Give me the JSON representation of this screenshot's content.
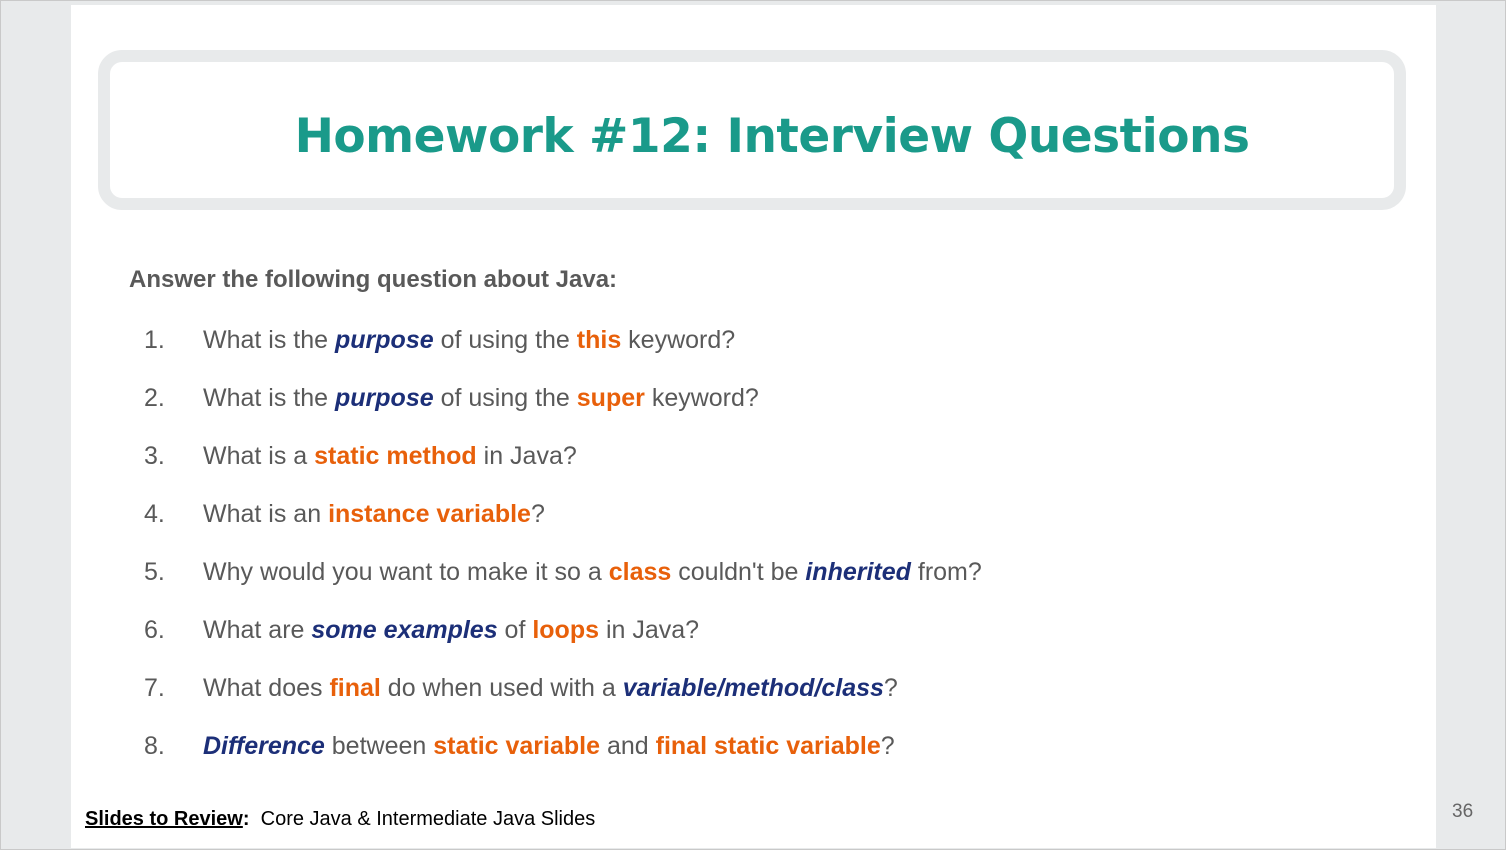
{
  "slide": {
    "title": "Homework #12: Interview Questions",
    "intro": "Answer the following question about Java:",
    "questions": [
      {
        "num": "1.",
        "parts": [
          {
            "t": "What is the ",
            "s": "n"
          },
          {
            "t": "purpose",
            "s": "b"
          },
          {
            "t": " of using the ",
            "s": "n"
          },
          {
            "t": "this",
            "s": "o"
          },
          {
            "t": " keyword?",
            "s": "n"
          }
        ]
      },
      {
        "num": "2.",
        "parts": [
          {
            "t": "What is the ",
            "s": "n"
          },
          {
            "t": "purpose",
            "s": "b"
          },
          {
            "t": " of using the ",
            "s": "n"
          },
          {
            "t": "super",
            "s": "o"
          },
          {
            "t": " keyword?",
            "s": "n"
          }
        ]
      },
      {
        "num": "3.",
        "parts": [
          {
            "t": "What is a ",
            "s": "n"
          },
          {
            "t": "static method",
            "s": "o"
          },
          {
            "t": " in Java?",
            "s": "n"
          }
        ]
      },
      {
        "num": "4.",
        "parts": [
          {
            "t": "What is an ",
            "s": "n"
          },
          {
            "t": "instance variable",
            "s": "o"
          },
          {
            "t": "?",
            "s": "n"
          }
        ]
      },
      {
        "num": "5.",
        "parts": [
          {
            "t": "Why would you want to make it so a ",
            "s": "n"
          },
          {
            "t": "class",
            "s": "o"
          },
          {
            "t": " couldn't be ",
            "s": "n"
          },
          {
            "t": "inherited",
            "s": "b"
          },
          {
            "t": " from?",
            "s": "n"
          }
        ]
      },
      {
        "num": "6.",
        "parts": [
          {
            "t": "What are ",
            "s": "n"
          },
          {
            "t": "some examples",
            "s": "b"
          },
          {
            "t": " of ",
            "s": "n"
          },
          {
            "t": "loops",
            "s": "o"
          },
          {
            "t": " in Java?",
            "s": "n"
          }
        ]
      },
      {
        "num": "7.",
        "parts": [
          {
            "t": "What does ",
            "s": "n"
          },
          {
            "t": "final",
            "s": "o"
          },
          {
            "t": " do when used with a ",
            "s": "n"
          },
          {
            "t": "variable/method/class",
            "s": "b"
          },
          {
            "t": "?",
            "s": "n"
          }
        ]
      },
      {
        "num": "8.",
        "parts": [
          {
            "t": "Difference",
            "s": "b"
          },
          {
            "t": " between ",
            "s": "n"
          },
          {
            "t": "static variable",
            "s": "o"
          },
          {
            "t": " and ",
            "s": "n"
          },
          {
            "t": "final static variable",
            "s": "o"
          },
          {
            "t": "?",
            "s": "n"
          }
        ]
      }
    ],
    "footer": {
      "label": "Slides to Review",
      "colon": ":",
      "text": "  Core Java & Intermediate Java Slides"
    },
    "page_number": "36"
  },
  "colors": {
    "title": "#1a9a8a",
    "highlight_orange": "#e8600a",
    "highlight_blue": "#1c2f78",
    "body_text": "#595959",
    "frame_gray": "#e8eaeb"
  }
}
